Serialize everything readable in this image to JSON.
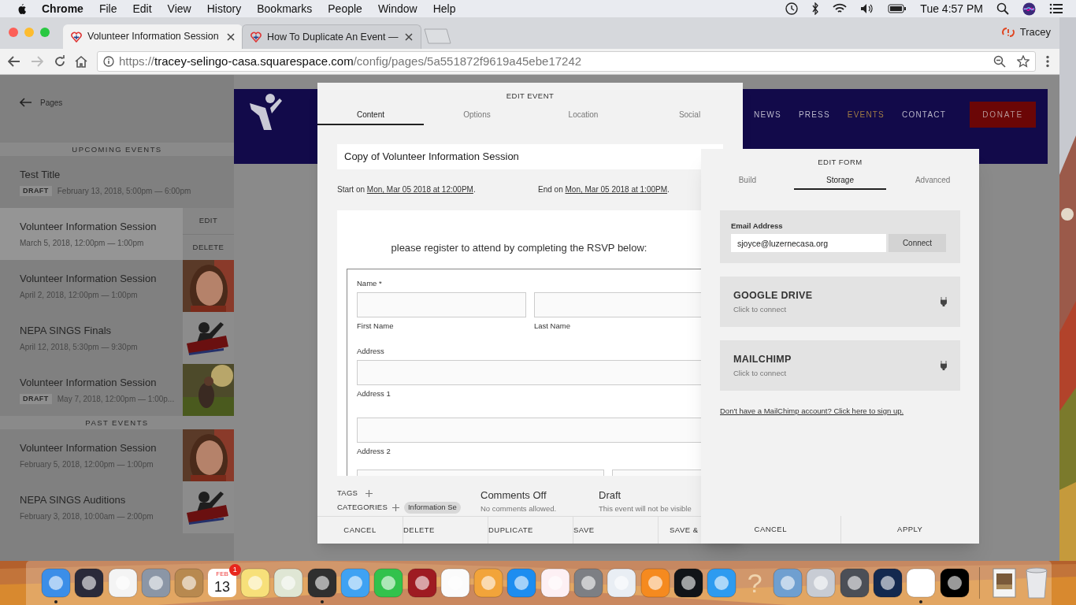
{
  "menubar": {
    "app": "Chrome",
    "menus": [
      "File",
      "Edit",
      "View",
      "History",
      "Bookmarks",
      "People",
      "Window",
      "Help"
    ],
    "clock": "Tue 4:57 PM"
  },
  "browser": {
    "tabs": [
      {
        "title": "Volunteer Information Session",
        "selected": true
      },
      {
        "title": "How To Duplicate An Event —",
        "selected": false
      }
    ],
    "profile": "Tracey",
    "url": {
      "scheme": "https://",
      "host": "tracey-selingo-casa.squarespace.com",
      "path": "/config/pages/5a551872f9619a45ebe17242"
    }
  },
  "sidebar": {
    "back": "Pages",
    "sections": [
      {
        "heading": "UPCOMING EVENTS",
        "events": [
          {
            "title": "Test Title",
            "date": "February 13, 2018, 5:00pm — 6:00pm",
            "badge": "DRAFT",
            "selected": false
          },
          {
            "title": "Volunteer Information Session",
            "date": "March 5, 2018, 12:00pm — 1:00pm",
            "selected": true,
            "actions": [
              "EDIT",
              "DELETE"
            ]
          },
          {
            "title": "Volunteer Information Session",
            "date": "April 2, 2018, 12:00pm — 1:00pm",
            "selected": false
          },
          {
            "title": "NEPA SINGS Finals",
            "date": "April 12, 2018, 5:30pm — 9:30pm",
            "selected": false
          },
          {
            "title": "Volunteer Information Session",
            "date": "May 7, 2018, 12:00pm — 1:00p...",
            "badge": "DRAFT",
            "selected": false
          }
        ]
      },
      {
        "heading": "PAST EVENTS",
        "events": [
          {
            "title": "Volunteer Information Session",
            "date": "February 5, 2018, 12:00pm — 1:00pm",
            "selected": false
          },
          {
            "title": "NEPA SINGS Auditions",
            "date": "February 3, 2018, 10:00am — 2:00pm",
            "selected": false
          }
        ]
      }
    ]
  },
  "site_nav": {
    "items": [
      {
        "label": "NEWS",
        "selected": false
      },
      {
        "label": "PRESS",
        "selected": false
      },
      {
        "label": "EVENTS",
        "selected": true
      },
      {
        "label": "CONTACT",
        "selected": false
      }
    ],
    "donate": "DONATE"
  },
  "edit_event": {
    "heading": "EDIT EVENT",
    "tabs": [
      {
        "label": "Content",
        "selected": true
      },
      {
        "label": "Options",
        "selected": false
      },
      {
        "label": "Location",
        "selected": false
      },
      {
        "label": "Social",
        "selected": false
      }
    ],
    "title_value": "Copy of Volunteer Information Session",
    "start": {
      "label": "Start on",
      "value": "Mon, Mar 05 2018 at 12:00PM",
      "end_mark": "."
    },
    "end": {
      "label": "End on",
      "value": "Mon, Mar 05 2018 at 1:00PM",
      "end_mark": "."
    },
    "intro": "please register to attend by completing the RSVP below:",
    "form": {
      "name_label": "Name *",
      "first": "First Name",
      "last": "Last Name",
      "address_label": "Address",
      "address_1": "Address 1",
      "address_2": "Address 2"
    },
    "tags_label": "TAGS",
    "categories_label": "CATEGORIES",
    "category": "Information Se",
    "comments": {
      "title": "Comments Off",
      "note": "No comments allowed."
    },
    "status": {
      "title": "Draft",
      "note": "This event will not be visible"
    },
    "buttons": [
      "CANCEL",
      "DELETE",
      "DUPLICATE",
      "SAVE",
      "SAVE &"
    ]
  },
  "edit_form": {
    "heading": "EDIT FORM",
    "tabs": [
      {
        "label": "Build",
        "selected": false
      },
      {
        "label": "Storage",
        "selected": true
      },
      {
        "label": "Advanced",
        "selected": false
      }
    ],
    "email_label": "Email Address",
    "email_value": "sjoyce@luzernecasa.org",
    "connect": "Connect",
    "services": [
      {
        "name": "GOOGLE DRIVE",
        "hint": "Click to connect"
      },
      {
        "name": "MAILCHIMP",
        "hint": "Click to connect"
      }
    ],
    "signup_link": "Don't have a MailChimp account? Click here to sign up.",
    "buttons": [
      "CANCEL",
      "APPLY"
    ]
  },
  "dock": {
    "items": [
      {
        "kind": "app",
        "color": "#3b8ee8",
        "running": true
      },
      {
        "kind": "app",
        "color": "#2a2a3a",
        "running": false
      },
      {
        "kind": "app",
        "color": "#f4f4f4",
        "running": false
      },
      {
        "kind": "app",
        "color": "#8b96a6",
        "running": false
      },
      {
        "kind": "app",
        "color": "#b8894f",
        "running": false
      },
      {
        "kind": "calendar",
        "month": "FEB",
        "day": "13",
        "badge": "1",
        "running": false
      },
      {
        "kind": "app",
        "color": "#f7e07a",
        "running": false
      },
      {
        "kind": "app",
        "color": "#dfe6d4",
        "running": false
      },
      {
        "kind": "app",
        "color": "#2f2f2f",
        "running": true
      },
      {
        "kind": "app",
        "color": "#3fa2f3",
        "running": false
      },
      {
        "kind": "app",
        "color": "#32c24c",
        "running": false
      },
      {
        "kind": "app",
        "color": "#9e1b22",
        "running": false
      },
      {
        "kind": "app",
        "color": "#fbfbfb",
        "running": false
      },
      {
        "kind": "app",
        "color": "#f2a43a",
        "running": false
      },
      {
        "kind": "app",
        "color": "#1d8df0",
        "running": false
      },
      {
        "kind": "app",
        "color": "#fdf0f4",
        "running": false
      },
      {
        "kind": "app",
        "color": "#7d7f84",
        "running": false
      },
      {
        "kind": "app",
        "color": "#e9eef4",
        "running": false
      },
      {
        "kind": "app",
        "color": "#f58a1f",
        "running": false
      },
      {
        "kind": "app",
        "color": "#111418",
        "running": false
      },
      {
        "kind": "app",
        "color": "#2d9bf0",
        "running": false
      },
      {
        "kind": "missing",
        "glyph": "?",
        "running": false
      },
      {
        "kind": "app",
        "color": "#6f9fd0",
        "running": false
      },
      {
        "kind": "app",
        "color": "#c8ccd4",
        "running": false
      },
      {
        "kind": "app",
        "color": "#4b4f57",
        "running": false
      },
      {
        "kind": "app",
        "color": "#13294f",
        "running": false
      },
      {
        "kind": "app",
        "color": "#ffffff",
        "running": true
      },
      {
        "kind": "app",
        "color": "#000000",
        "running": false
      },
      {
        "kind": "separator"
      },
      {
        "kind": "stack",
        "running": false
      },
      {
        "kind": "trash",
        "running": false
      }
    ]
  }
}
